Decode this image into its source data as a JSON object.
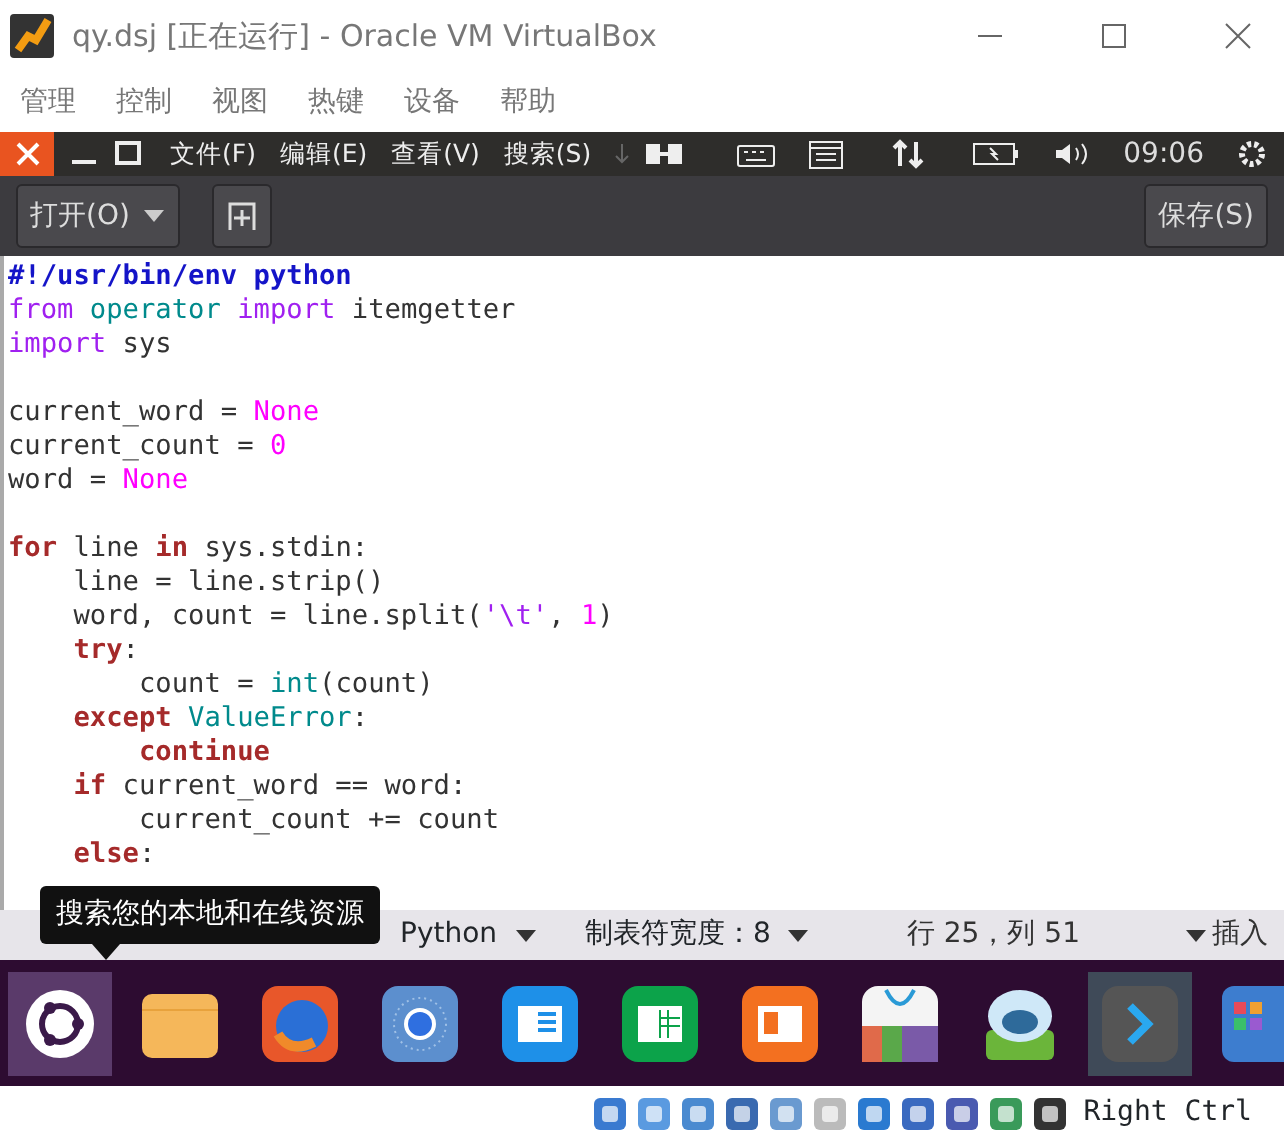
{
  "window": {
    "title": "qy.dsj [正在运行] - Oracle VM VirtualBox"
  },
  "menu": [
    "管理",
    "控制",
    "视图",
    "热键",
    "设备",
    "帮助"
  ],
  "panel": {
    "menus": [
      "文件(F)",
      "编辑(E)",
      "查看(V)",
      "搜索(S)"
    ],
    "clock": "09:06"
  },
  "toolbar": {
    "open": "打开(O)",
    "save": "保存(S)"
  },
  "editor": {
    "lines": [
      {
        "kind": "code",
        "tokens": [
          {
            "text": "#!/usr/bin/env python",
            "kind": "comment"
          }
        ]
      },
      {
        "kind": "code",
        "tokens": [
          {
            "text": "from",
            "kind": "import"
          },
          {
            "text": " operator",
            "kind": "module"
          },
          {
            "text": " import",
            "kind": "import"
          },
          {
            "text": " itemgetter",
            "kind": "plain"
          }
        ]
      },
      {
        "kind": "code",
        "tokens": [
          {
            "text": "import",
            "kind": "import"
          },
          {
            "text": " sys",
            "kind": "plain"
          }
        ]
      },
      {
        "kind": "blank"
      },
      {
        "kind": "code",
        "tokens": [
          {
            "text": "current_word =",
            "kind": "plain"
          },
          {
            "text": " None",
            "kind": "constant"
          }
        ]
      },
      {
        "kind": "code",
        "tokens": [
          {
            "text": "current_count =",
            "kind": "plain"
          },
          {
            "text": " 0",
            "kind": "constant"
          }
        ]
      },
      {
        "kind": "code",
        "tokens": [
          {
            "text": "word =",
            "kind": "plain"
          },
          {
            "text": " None",
            "kind": "constant"
          }
        ]
      },
      {
        "kind": "blank"
      },
      {
        "kind": "code",
        "tokens": [
          {
            "text": "for",
            "kind": "keyword"
          },
          {
            "text": " line",
            "kind": "plain"
          },
          {
            "text": " in",
            "kind": "keyword"
          },
          {
            "text": " sys.stdin:",
            "kind": "plain"
          }
        ]
      },
      {
        "kind": "code",
        "tokens": [
          {
            "text": "    line = line.strip()",
            "kind": "plain"
          }
        ]
      },
      {
        "kind": "code",
        "tokens": [
          {
            "text": "    word, count = line.split(",
            "kind": "plain"
          },
          {
            "text": "'\\t'",
            "kind": "string"
          },
          {
            "text": ",",
            "kind": "plain"
          },
          {
            "text": " 1",
            "kind": "constant"
          },
          {
            "text": ")",
            "kind": "plain"
          }
        ]
      },
      {
        "kind": "code",
        "tokens": [
          {
            "text": "    try",
            "kind": "keyword"
          },
          {
            "text": ":",
            "kind": "plain"
          }
        ]
      },
      {
        "kind": "code",
        "tokens": [
          {
            "text": "        count =",
            "kind": "plain"
          },
          {
            "text": " int",
            "kind": "builtin"
          },
          {
            "text": "(count)",
            "kind": "plain"
          }
        ]
      },
      {
        "kind": "code",
        "tokens": [
          {
            "text": "    except",
            "kind": "keyword"
          },
          {
            "text": " ValueError",
            "kind": "builtin"
          },
          {
            "text": ":",
            "kind": "plain"
          }
        ]
      },
      {
        "kind": "code",
        "tokens": [
          {
            "text": "        continue",
            "kind": "keyword"
          }
        ]
      },
      {
        "kind": "code",
        "tokens": [
          {
            "text": "    if",
            "kind": "keyword"
          },
          {
            "text": " current_word == word:",
            "kind": "plain"
          }
        ]
      },
      {
        "kind": "code",
        "tokens": [
          {
            "text": "        current_count += count",
            "kind": "plain"
          }
        ]
      },
      {
        "kind": "code",
        "tokens": [
          {
            "text": "    else",
            "kind": "keyword"
          },
          {
            "text": ":",
            "kind": "plain"
          }
        ]
      }
    ]
  },
  "tooltip": "搜索您的本地和在线资源",
  "status_bar": {
    "language": "Python",
    "tab_width": "制表符宽度：8",
    "position": "行 25，列 51",
    "mode": "插入"
  },
  "dock": [
    {
      "kind": "ubuntu",
      "selected": true
    },
    {
      "kind": "folder",
      "selected": false
    },
    {
      "kind": "firefox",
      "selected": false
    },
    {
      "kind": "chromium",
      "selected": false
    },
    {
      "kind": "word",
      "selected": false
    },
    {
      "kind": "excel",
      "selected": false
    },
    {
      "kind": "ppt",
      "selected": false
    },
    {
      "kind": "store",
      "selected": false
    },
    {
      "kind": "robot",
      "selected": false
    },
    {
      "kind": "terminal",
      "selected": true
    },
    {
      "kind": "apps",
      "selected": false
    }
  ],
  "vbox_status": {
    "host_key": "Right Ctrl"
  }
}
